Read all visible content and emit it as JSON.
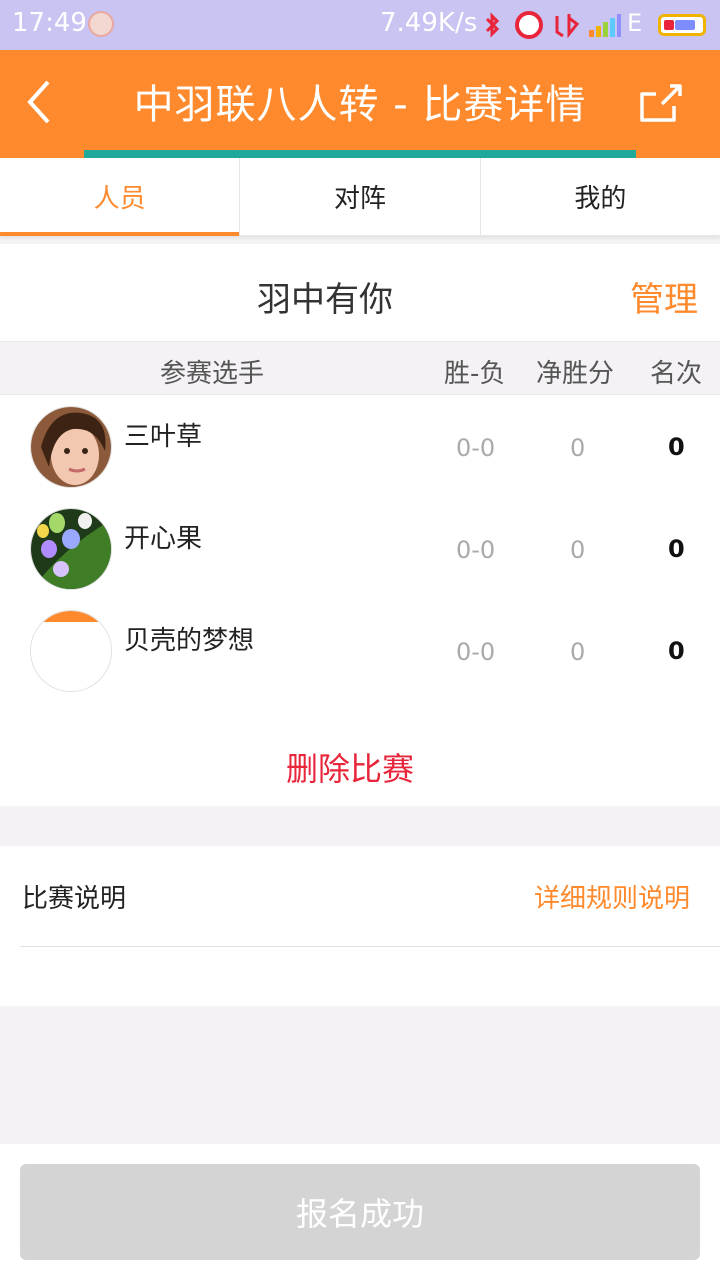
{
  "status_bar": {
    "time": "17:49",
    "net_speed": "7.49K/s",
    "network_type": "E",
    "icons": [
      "avatar-icon",
      "bluetooth-icon",
      "alarm-icon",
      "app-icon",
      "signal-icon",
      "battery-icon"
    ]
  },
  "header": {
    "title": "中羽联八人转 - 比赛详情",
    "back_icon": "chevron-left-icon",
    "share_icon": "share-icon"
  },
  "tabs": [
    {
      "label": "人员",
      "active": true
    },
    {
      "label": "对阵",
      "active": false
    },
    {
      "label": "我的",
      "active": false
    }
  ],
  "team": {
    "name": "羽中有你",
    "manage_label": "管理"
  },
  "table": {
    "headers": {
      "player": "参赛选手",
      "win_loss": "胜-负",
      "net": "净胜分",
      "rank": "名次"
    },
    "rows": [
      {
        "name": "三叶草",
        "win_loss": "0-0",
        "net": "0",
        "rank": "0"
      },
      {
        "name": "开心果",
        "win_loss": "0-0",
        "net": "0",
        "rank": "0"
      },
      {
        "name": "贝壳的梦想",
        "win_loss": "0-0",
        "net": "0",
        "rank": "0"
      }
    ]
  },
  "delete_label": "删除比赛",
  "description": {
    "label": "比赛说明",
    "link": "详细规则说明"
  },
  "signup_label": "报名成功",
  "colors": {
    "accent": "#ff8a2d",
    "teal": "#1ea99b",
    "danger": "#e8253a",
    "disabled": "#d4d4d4"
  }
}
